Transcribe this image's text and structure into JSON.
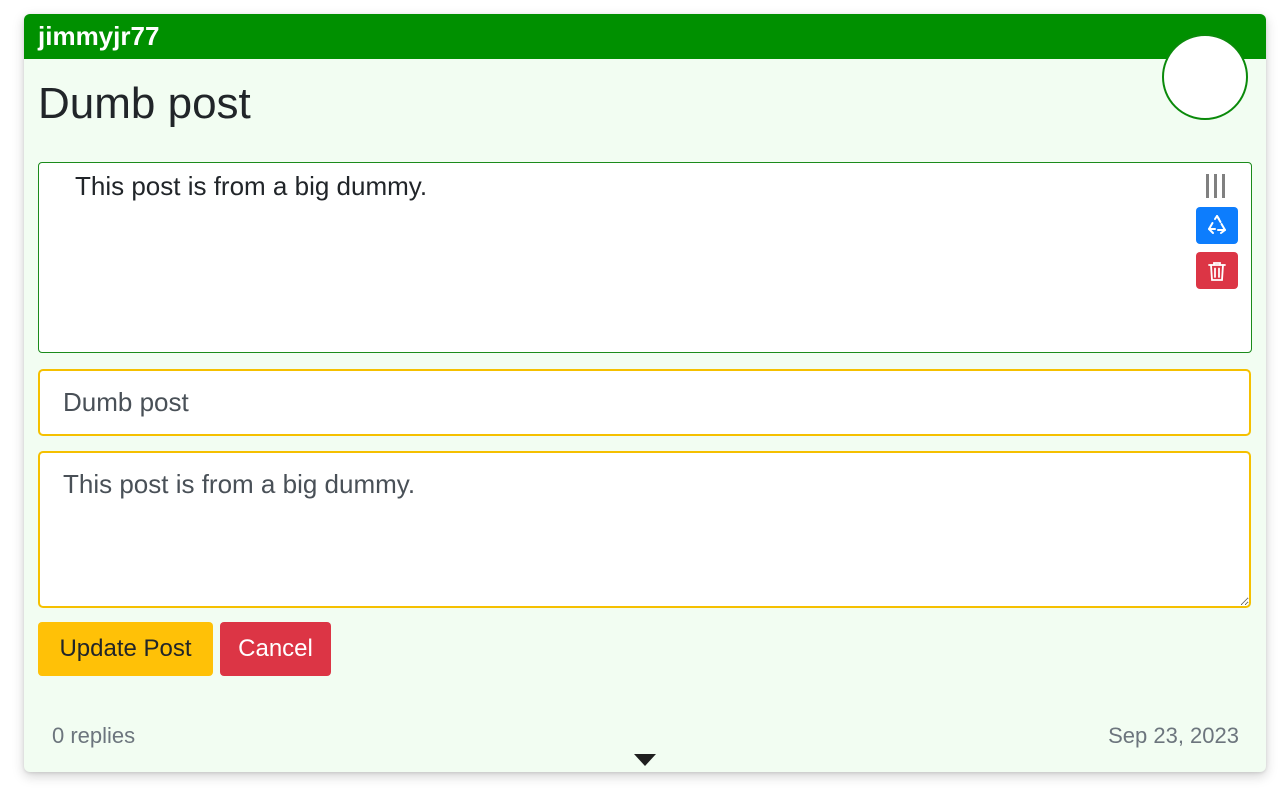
{
  "post": {
    "username": "jimmyjr77",
    "title": "Dumb post",
    "content": "This post is from a big dummy.",
    "replies_label": "0 replies",
    "date": "Sep 23, 2023"
  },
  "edit_form": {
    "title_value": "Dumb post",
    "body_value": "This post is from a big dummy.",
    "update_label": "Update Post",
    "cancel_label": "Cancel"
  },
  "icons": {
    "drag": "drag-handle-icon",
    "recycle": "recycle-icon",
    "trash": "trash-icon",
    "expand": "caret-down-icon"
  },
  "colors": {
    "header": "#009000",
    "card_background": "#f2fdf2",
    "input_border": "#f5c000",
    "update_button": "#ffc107",
    "cancel_button": "#dc3545",
    "recycle_button": "#0d7dfd"
  }
}
